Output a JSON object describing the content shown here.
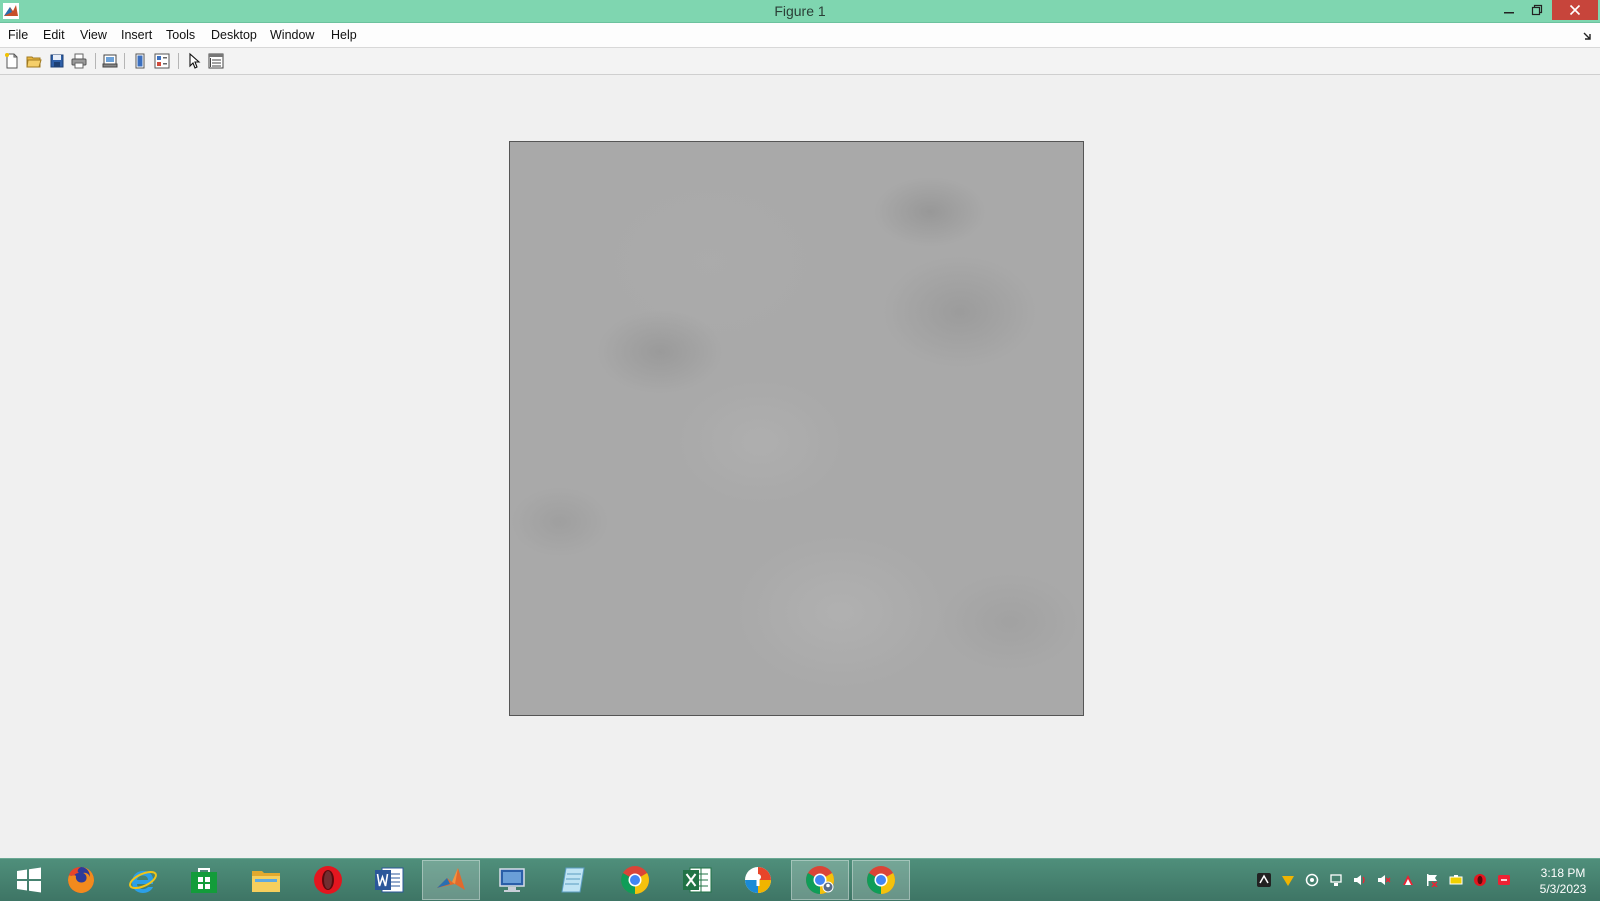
{
  "window": {
    "title": "Figure 1",
    "colors": {
      "titlebar": "#7fd6b0",
      "close": "#c7453b",
      "taskbar": "#4f8f7b"
    }
  },
  "menu": {
    "items": [
      "File",
      "Edit",
      "View",
      "Insert",
      "Tools",
      "Desktop",
      "Window",
      "Help"
    ]
  },
  "toolbar": {
    "buttons": [
      "new-figure-icon",
      "open-file-icon",
      "save-figure-icon",
      "print-figure-icon",
      "link-plot-icon",
      "hide-plot-tools-icon",
      "show-plot-tools-icon",
      "edit-plot-icon",
      "property-inspector-icon"
    ]
  },
  "figure": {
    "content": "grayscale-texture-image"
  },
  "taskbar": {
    "apps": [
      "windows-start-icon",
      "firefox-icon",
      "internet-explorer-icon",
      "store-icon",
      "file-explorer-icon",
      "opera-icon",
      "word-icon",
      "matlab-icon",
      "remote-desktop-icon",
      "notepad-icon",
      "chrome-icon",
      "excel-icon",
      "security-icon",
      "chrome-profile-icon",
      "chrome-icon"
    ],
    "active_app": "matlab-icon"
  },
  "tray": {
    "icons": [
      "app-tray-icon",
      "wifi-signal-icon",
      "sync-icon",
      "network-icon",
      "volume-icon",
      "mute-icon",
      "ink-icon",
      "flag-icon",
      "battery-icon",
      "opera-tray-icon",
      "notification-icon"
    ]
  },
  "clock": {
    "time": "3:18 PM",
    "date": "5/3/2023"
  }
}
